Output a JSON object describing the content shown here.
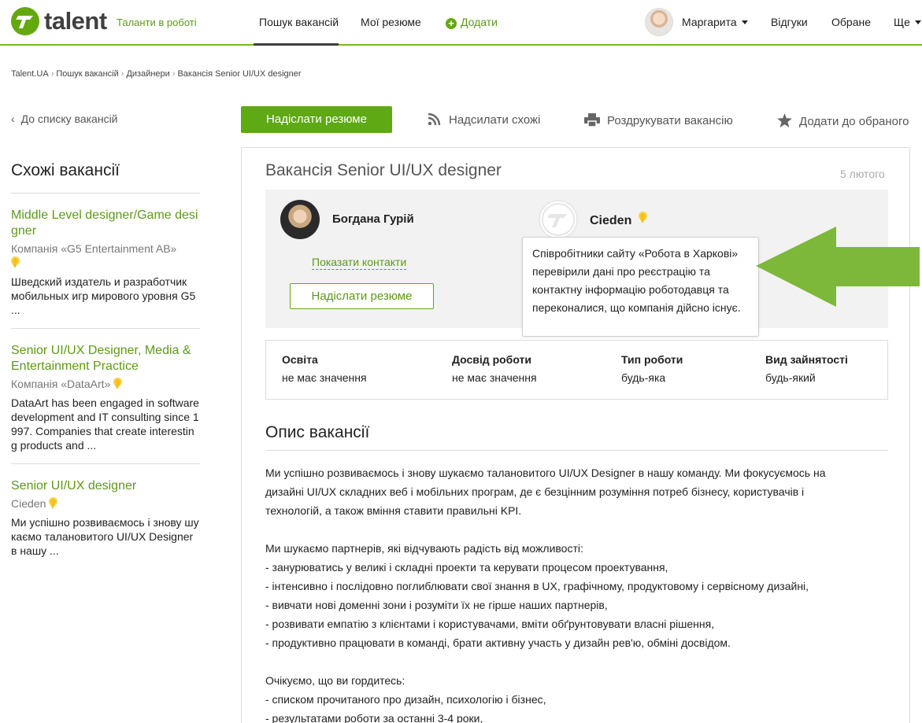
{
  "header": {
    "logo_text": "talent",
    "tagline": "Таланти в роботі",
    "nav": {
      "search_jobs": "Пошук вакансій",
      "my_resumes": "Мої резюме",
      "add": "Додати"
    },
    "user_name": "Маргарита",
    "responses": "Відгуки",
    "favorites": "Обране",
    "more": "Ще"
  },
  "breadcrumb": [
    "Talent.UA",
    "Пошук вакансій",
    "Дизайнери",
    "Вакансія Senior UI/UX designer"
  ],
  "back_link": "До списку вакансій",
  "similar": {
    "title": "Схожі вакансії",
    "items": [
      {
        "title": "Middle Level designer/Game designer",
        "company": "Компанія «G5 Entertainment AB»",
        "desc": "Шведский издатель и разработчик мобильных игр мирового уровня G5 ..."
      },
      {
        "title": "Senior UI/UX Designer, Media & Entertainment Practice",
        "company": "Компанія «DataArt»",
        "desc": "DataArt has been engaged in software development and IT consulting since 1997. Companies that create interesting products and ..."
      },
      {
        "title": "Senior UI/UX designer",
        "company": "Cieden",
        "desc": "Ми успішно розвиваємось і знову шукаємо таланови­того UI/UX Designer в нашу ..."
      }
    ]
  },
  "actions": {
    "send_resume": "Надіслати резюме",
    "send_similar": "Надсилати схожі",
    "print": "Роздрукувати вакансію",
    "add_favorite": "Додати до обраного"
  },
  "vacancy": {
    "title": "Вакансія Senior UI/UX designer",
    "date": "5 лютого",
    "contact_name": "Богдана Гурій",
    "show_contacts": "Показати контакти",
    "send_resume": "Надіслати резюме",
    "company": "Cieden",
    "tooltip": "Співробітники сайту «Робота в Харкові» перевірили дані про реєстрацію та контактну інформацію роботодавця та переконалися, що компанія дійсно існує.",
    "facts": [
      {
        "label": "Освіта",
        "value": "не має значення"
      },
      {
        "label": "Досвід роботи",
        "value": "не має значення"
      },
      {
        "label": "Тип роботи",
        "value": "будь-яка"
      },
      {
        "label": "Вид зайнятості",
        "value": "будь-який"
      }
    ],
    "description_title": "Опис вакансії",
    "description_lines": [
      "Ми успішно розвиваємось і знову шукаємо талановитого UI/UX Designer в нашу команду. Ми фокусуємось на",
      "дизайні UI/UX складних веб і мобільних програм, де є безцінним розуміння потреб бізнесу, користувачів і",
      "технологій, а також вміння ставити правильні KPI.",
      "",
      "Ми шукаємо партнерів, які відчувають радість від можливості:",
      "- занурюватись у великі і складні проекти та керувати процесом проектування,",
      "- інтенсивно і послідовно поглиблювати свої знання в UX, графічному, продуктовому і сервісному дизайні,",
      "- вивчати нові доменні зони і розуміти їх не гірше наших партнерів,",
      "- розвивати емпатію з клієнтами і користувачами, вміти обґрунтовувати власні рішення,",
      "- продуктивно працювати в команді, брати активну участь у дизайн рев'ю, обміні досвідом.",
      "",
      "Очікуємо, що ви гордитесь:",
      "- списком прочитаного про дизайн, психологію і бізнес,",
      "- результатами роботи за останні 3-4 роки,"
    ]
  },
  "colors": {
    "brand_green": "#5ea914",
    "link_green": "#5c9a17",
    "arrow_green": "#7db83a"
  }
}
